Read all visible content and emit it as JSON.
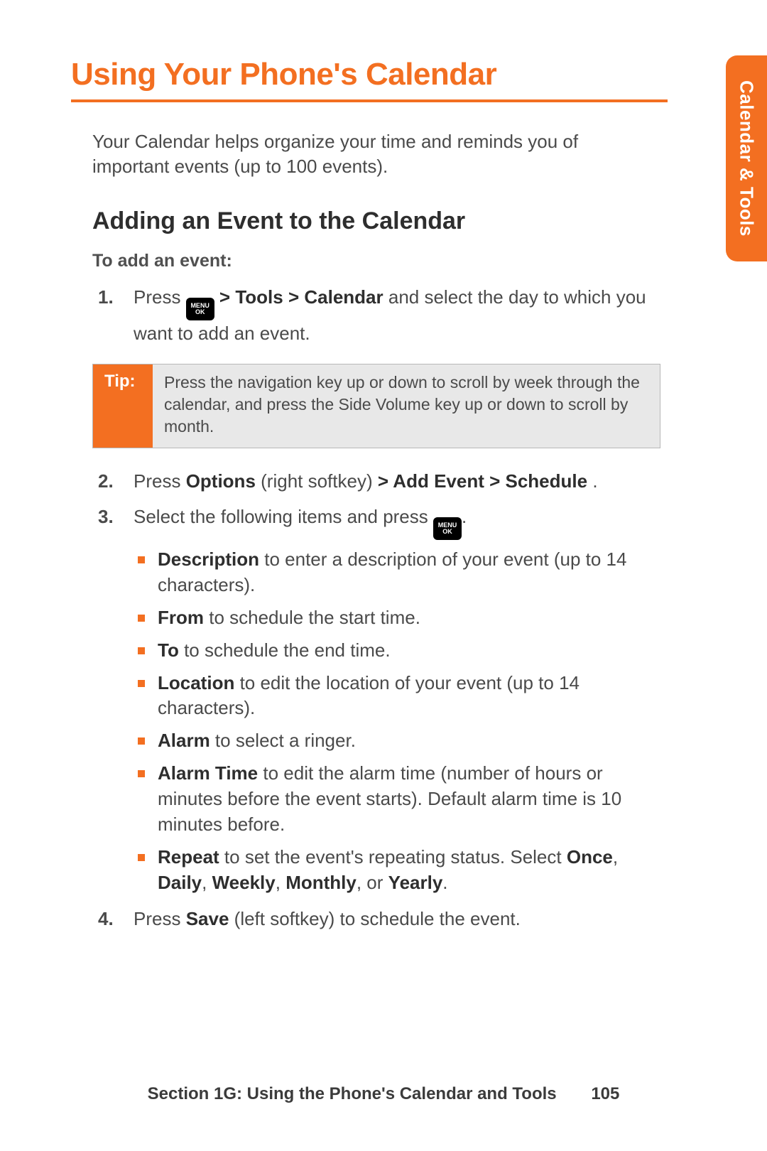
{
  "side_tab": "Calendar & Tools",
  "title": "Using Your Phone's Calendar",
  "intro": "Your Calendar helps organize your time and reminds you of important events (up to 100 events).",
  "subhead": "Adding an Event to the Calendar",
  "lead": "To add an event:",
  "menu_key": {
    "line1": "MENU",
    "line2": "OK"
  },
  "steps": {
    "s1": {
      "num": "1.",
      "pre": "Press ",
      "bold_path": " > Tools > Calendar",
      "post": " and select the day to which you want to add an event."
    },
    "s2": {
      "num": "2.",
      "t1": "Press ",
      "b1": "Options",
      "t2": " (right softkey) ",
      "b2": "> Add Event > Schedule",
      "t3": "."
    },
    "s3": {
      "num": "3.",
      "pre": "Select the following items and press ",
      "post": ".",
      "items": [
        {
          "label": "Description",
          "rest": " to enter a description of your event (up to 14 characters)."
        },
        {
          "label": "From",
          "rest": " to schedule the start time."
        },
        {
          "label": "To",
          "rest": " to schedule the end time."
        },
        {
          "label": "Location",
          "rest": " to edit the location of your event (up to 14 characters)."
        },
        {
          "label": "Alarm",
          "rest": " to select a ringer."
        },
        {
          "label": "Alarm Time",
          "rest": " to edit the alarm time (number of hours or minutes before the event starts). Default alarm time is 10 minutes before."
        }
      ],
      "repeat": {
        "label": "Repeat",
        "t1": " to set the event's repeating status. Select ",
        "o1": "Once",
        "o2": "Daily",
        "o3": "Weekly",
        "o4": "Monthly",
        "o5": "Yearly",
        "sep": ", ",
        "or": ", or ",
        "end": "."
      }
    },
    "s4": {
      "num": "4.",
      "t1": "Press ",
      "b1": "Save",
      "t2": " (left softkey) to schedule the event."
    }
  },
  "tip": {
    "label": "Tip:",
    "body": "Press the navigation key up or down to scroll by week through the calendar, and press the Side Volume key up or down to scroll by month."
  },
  "footer": {
    "section": "Section 1G: Using the Phone's Calendar and Tools",
    "page": "105"
  }
}
